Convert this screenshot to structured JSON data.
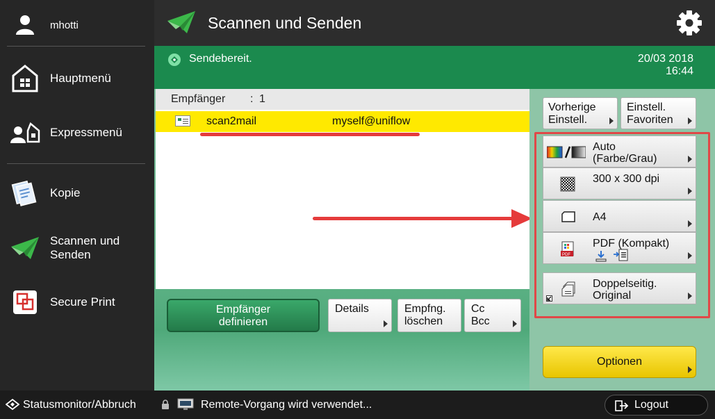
{
  "user": {
    "name": "mhotti"
  },
  "sidebar": {
    "items": [
      {
        "label": "Hauptmenü",
        "icon": "home-icon"
      },
      {
        "label": "Expressmenü",
        "icon": "express-menu-icon"
      },
      {
        "label": "Kopie",
        "icon": "copy-icon"
      },
      {
        "label": "Scannen und Senden",
        "icon": "scan-send-icon"
      },
      {
        "label": "Secure Print",
        "icon": "secure-print-icon"
      }
    ]
  },
  "header": {
    "title": "Scannen und Senden"
  },
  "status": {
    "text": "Sendebereit.",
    "date": "20/03 2018",
    "time": "16:44"
  },
  "recipients": {
    "header_label": "Empfänger",
    "colon": ":",
    "count": "1",
    "rows": [
      {
        "name": "scan2mail",
        "address": "myself@uniflow"
      }
    ]
  },
  "actions": {
    "define": "Empfänger definieren",
    "details": "Details",
    "delete": "Empfng. löschen",
    "cc_bcc": "Cc Bcc"
  },
  "right_panel": {
    "previous": "Vorherige Einstell.",
    "favorites": "Einstell. Favoriten",
    "settings": [
      {
        "label": "Auto (Farbe/Grau)",
        "icon": "color-mode-icon"
      },
      {
        "label": "300 x 300 dpi",
        "icon": "resolution-icon"
      },
      {
        "label": "A4",
        "icon": "paper-size-icon"
      },
      {
        "label": "PDF (Kompakt)",
        "icon": "pdf-icon"
      },
      {
        "label": "Doppelseitig. Original",
        "icon": "duplex-icon"
      }
    ],
    "options": "Optionen"
  },
  "footer": {
    "status_monitor": "Statusmonitor/Abbruch",
    "message": "Remote-Vorgang wird verwendet...",
    "logout": "Logout"
  },
  "colors": {
    "accent_green": "#1b8a4e",
    "highlight_yellow": "#ffe900",
    "annotation_red": "#e04848"
  }
}
